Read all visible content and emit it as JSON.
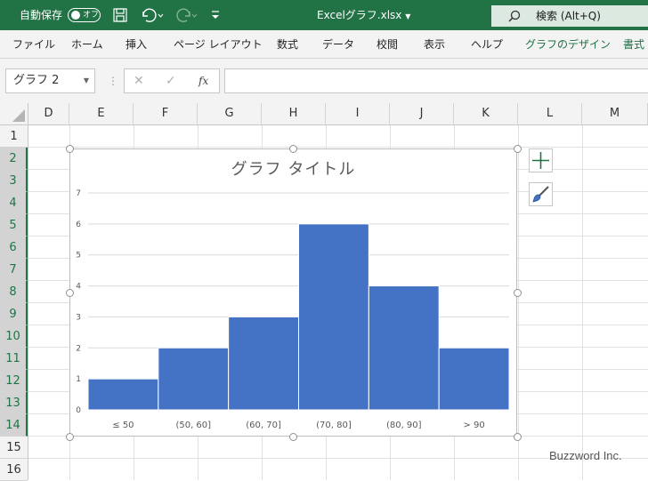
{
  "titlebar": {
    "autosave_label": "自動保存",
    "autosave_state": "オフ",
    "filename": "Excelグラフ.xlsx",
    "search_label": "検索 (Alt+Q)"
  },
  "ribbon_tabs": [
    "ファイル",
    "ホーム",
    "挿入",
    "ページ レイアウト",
    "数式",
    "データ",
    "校閲",
    "表示",
    "ヘルプ",
    "グラフのデザイン",
    "書式"
  ],
  "formula_bar": {
    "name_box": "グラフ 2",
    "fx": "fx",
    "cancel": "✕",
    "enter": "✓"
  },
  "columns": [
    "D",
    "E",
    "F",
    "G",
    "H",
    "I",
    "J",
    "K",
    "L",
    "M"
  ],
  "rows": [
    "1",
    "2",
    "3",
    "4",
    "5",
    "6",
    "7",
    "8",
    "9",
    "10",
    "11",
    "12",
    "13",
    "14",
    "15",
    "16"
  ],
  "colors": {
    "excel_green": "#217346",
    "bar_fill": "#4472c4"
  },
  "chart_data": {
    "type": "bar",
    "title": "グラフ タイトル",
    "categories": [
      "≤ 50",
      "(50, 60]",
      "(60, 70]",
      "(70, 80]",
      "(80, 90]",
      "> 90"
    ],
    "values": [
      1,
      2,
      3,
      6,
      4,
      2
    ],
    "yticks": [
      "0",
      "1",
      "2",
      "3",
      "4",
      "5",
      "6",
      "7"
    ],
    "ylim": [
      0,
      7
    ],
    "grid": true,
    "legend": "none"
  },
  "watermark": "Buzzword Inc."
}
